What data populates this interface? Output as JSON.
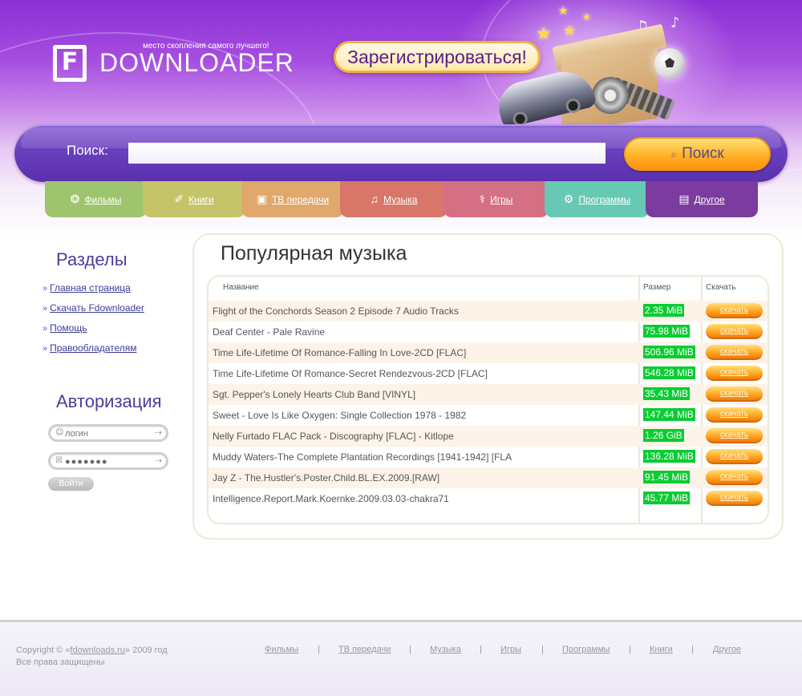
{
  "header": {
    "logo_letter": "F",
    "logo_text": "DOWNLOADER",
    "tagline": "место скопления самого лучшего!",
    "register_label": "Зарегистрироваться!"
  },
  "search": {
    "label": "Поиск:",
    "value": "",
    "button_label": "Поиск"
  },
  "categories": [
    {
      "label": "Фильмы",
      "icon": "film-reel-icon",
      "color": "#9fc46e"
    },
    {
      "label": "Книги",
      "icon": "book-icon",
      "color": "#c6c468"
    },
    {
      "label": "ТВ передачи",
      "icon": "tv-icon",
      "color": "#e0a86c"
    },
    {
      "label": "Музыка",
      "icon": "music-note-icon",
      "color": "#d8766a"
    },
    {
      "label": "Игры",
      "icon": "joystick-icon",
      "color": "#d46f84"
    },
    {
      "label": "Программы",
      "icon": "gears-icon",
      "color": "#67c9b4"
    },
    {
      "label": "Другое",
      "icon": "document-icon",
      "color": "#7c3b9e"
    }
  ],
  "sidebar": {
    "sections_title": "Разделы",
    "links": [
      "Главная страница",
      "Скачать Fdownloader",
      "Помощь",
      "Правообладателям"
    ],
    "auth_title": "Авторизация",
    "login_placeholder": "логин",
    "password_value": "●●●●●●●",
    "login_button": "Войти"
  },
  "main": {
    "title": "Популярная музыка",
    "columns": {
      "name": "Название",
      "size": "Размер",
      "download": "Скачать"
    },
    "download_label": "скачать",
    "rows": [
      {
        "name": "Flight of the Conchords Season 2 Episode 7 Audio Tracks",
        "size": "2.35 MiB"
      },
      {
        "name": "Deaf Center - Pale Ravine",
        "size": "75.98 MiB"
      },
      {
        "name": "Time Life-Lifetime Of Romance-Falling In Love-2CD [FLAC]",
        "size": "506.96 MiB"
      },
      {
        "name": "Time Life-Lifetime Of Romance-Secret Rendezvous-2CD [FLAC]",
        "size": "546.28 MiB"
      },
      {
        "name": "Sgt. Pepper's Lonely Hearts Club Band [VINYL]",
        "size": "35.43 MiB"
      },
      {
        "name": "Sweet - Love Is Like Oxygen: Single Collection 1978 - 1982",
        "size": "147.44 MiB"
      },
      {
        "name": "Nelly Furtado FLAC Pack - Discography [FLAC] - Kitlope",
        "size": "1.26 GiB"
      },
      {
        "name": "Muddy Waters-The Complete Plantation Recordings [1941-1942] [FLA",
        "size": "136.28 MiB"
      },
      {
        "name": "Jay Z - The.Hustler's.Poster.Child.BL.EX.2009.[RAW]",
        "size": "91.45 MiB"
      },
      {
        "name": "Intelligence.Report.Mark.Koernke.2009.03.03-chakra71",
        "size": "45.77 MiB"
      }
    ]
  },
  "footer": {
    "copyright_prefix": "Copyright © «",
    "site_link": "fdownloads.ru",
    "copyright_suffix": "» 2009 год",
    "rights": "Все права защищены",
    "nav": [
      "Фильмы",
      "ТВ передачи",
      "Музыка",
      "Игры",
      "Программы",
      "Книги",
      "Другое"
    ],
    "separator": "|"
  },
  "colors": {
    "header_purple": "#8b2fd6",
    "search_bar": "#6a3fbd",
    "search_button": "#ffb62d",
    "size_badge": "#0bcc33",
    "download_button": "#ffa825",
    "sidebar_title": "#4a3e9a"
  }
}
